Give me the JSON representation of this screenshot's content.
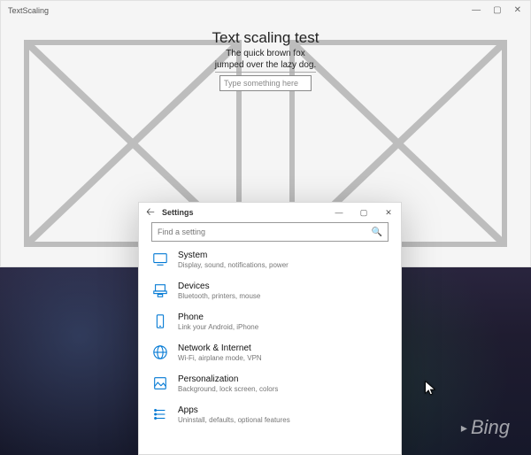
{
  "bing": "Bing",
  "app": {
    "title": "TextScaling",
    "heading": "Text scaling test",
    "subtext": "The quick brown fox\njumped over the lazy dog.",
    "placeholder": "Type something here"
  },
  "settings": {
    "title": "Settings",
    "search_placeholder": "Find a setting",
    "items": [
      {
        "label": "System",
        "desc": "Display, sound, notifications, power"
      },
      {
        "label": "Devices",
        "desc": "Bluetooth, printers, mouse"
      },
      {
        "label": "Phone",
        "desc": "Link your Android, iPhone"
      },
      {
        "label": "Network & Internet",
        "desc": "Wi-Fi, airplane mode, VPN"
      },
      {
        "label": "Personalization",
        "desc": "Background, lock screen, colors"
      },
      {
        "label": "Apps",
        "desc": "Uninstall, defaults, optional features"
      }
    ]
  }
}
